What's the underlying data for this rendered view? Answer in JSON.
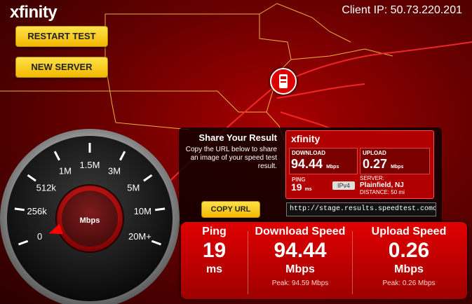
{
  "brand": {
    "logo": "xfinity"
  },
  "client_ip": "Client IP: 50.73.220.201",
  "buttons": {
    "restart": "RESTART TEST",
    "new_server": "NEW SERVER",
    "copy_url": "COPY URL"
  },
  "share": {
    "title": "Share Your Result",
    "description": "Copy the URL below to share an image of your speed test result.",
    "url": "http://stage.results.speedtest.comcast"
  },
  "card": {
    "logo": "xfinity",
    "download_label": "DOWNLOAD",
    "download_value": "94.44",
    "download_unit": "Mbps",
    "upload_label": "UPLOAD",
    "upload_value": "0.27",
    "upload_unit": "Mbps",
    "ping_label": "PING",
    "ping_value": "19",
    "ping_unit": "ms",
    "ip_version": "IPv4",
    "server_label": "SERVER:",
    "server_name": "Plainfield, NJ",
    "distance": "DISTANCE: 50 mi"
  },
  "gauge": {
    "unit": "Mbps",
    "ticks": [
      "0",
      "256k",
      "512k",
      "1M",
      "1.5M",
      "3M",
      "5M",
      "10M",
      "20M+"
    ],
    "needle_level_fraction": 0.0
  },
  "results": {
    "ping": {
      "title": "Ping",
      "value": "19",
      "unit": "ms"
    },
    "download": {
      "title": "Download Speed",
      "value": "94.44",
      "unit": "Mbps",
      "peak": "Peak: 94.59 Mbps"
    },
    "upload": {
      "title": "Upload Speed",
      "value": "0.26",
      "unit": "Mbps",
      "peak": "Peak: 0.26 Mbps"
    }
  },
  "colors": {
    "accent": "#e00000",
    "button": "#f7c600",
    "panel": "#1a0000"
  }
}
